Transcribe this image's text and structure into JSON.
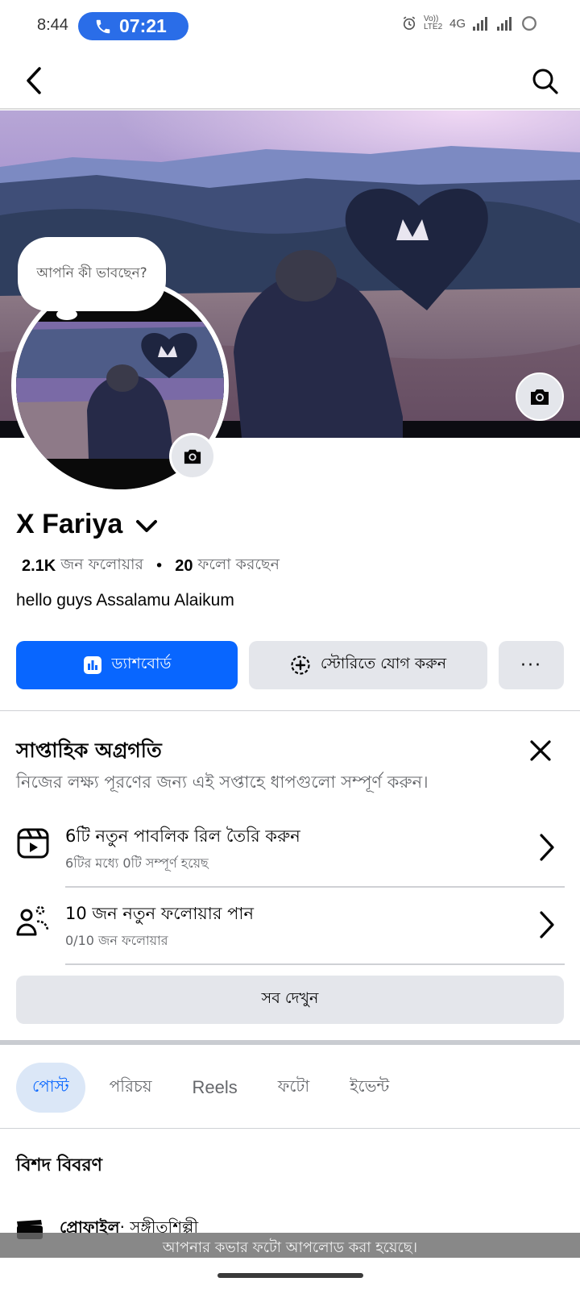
{
  "status_bar": {
    "time": "8:44",
    "call_time": "07:21",
    "network": "4G",
    "volte": "Vo)) LTE2"
  },
  "nav": {
    "back_icon": "chevron-left-icon",
    "search_icon": "search-icon"
  },
  "profile": {
    "thought_bubble": "আপনি কী ভাবছেন?",
    "name": "X Fariya",
    "followers_count": "2.1K",
    "followers_label": "জন ফলোয়ার",
    "following_count": "20",
    "following_label": "ফলো করছেন",
    "bio": "hello guys Assalamu Alaikum"
  },
  "actions": {
    "dashboard": "ড্যাশবোর্ড",
    "add_story": "স্টোরিতে যোগ করুন",
    "more": "···"
  },
  "weekly_progress": {
    "title": "সাপ্তাহিক অগ্রগতি",
    "subtitle": "নিজের লক্ষ্য পূরণের জন্য এই সপ্তাহে ধাপগুলো সম্পূর্ণ করুন।",
    "tasks": [
      {
        "title": "6টি নতুন পাবলিক রিল তৈরি করুন",
        "sub": "6টির মধ্যে 0টি সম্পূর্ণ হয়েছ",
        "icon": "reels-icon",
        "progress": 0
      },
      {
        "title": "10 জন নতুন ফলোয়ার পান",
        "sub": "0/10 জন ফলোয়ার",
        "icon": "followers-icon",
        "progress": 0
      }
    ],
    "see_all": "সব দেখুন"
  },
  "tabs": [
    {
      "label": "পোস্ট",
      "active": true
    },
    {
      "label": "পরিচয়",
      "active": false
    },
    {
      "label": "Reels",
      "active": false
    },
    {
      "label": "ফটো",
      "active": false
    },
    {
      "label": "ইভেন্ট",
      "active": false
    }
  ],
  "details": {
    "title": "বিশদ বিবরণ",
    "profile_label": "প্রোফাইল",
    "profile_value": " · সঙ্গীতশিল্পী"
  },
  "toast": "আপনার কভার ফটো আপলোড করা হয়েছে।",
  "colors": {
    "primary": "#0866ff",
    "call_pill": "#2a6de8",
    "button_gray": "#e4e6eb",
    "secondary_text": "#65676b"
  }
}
